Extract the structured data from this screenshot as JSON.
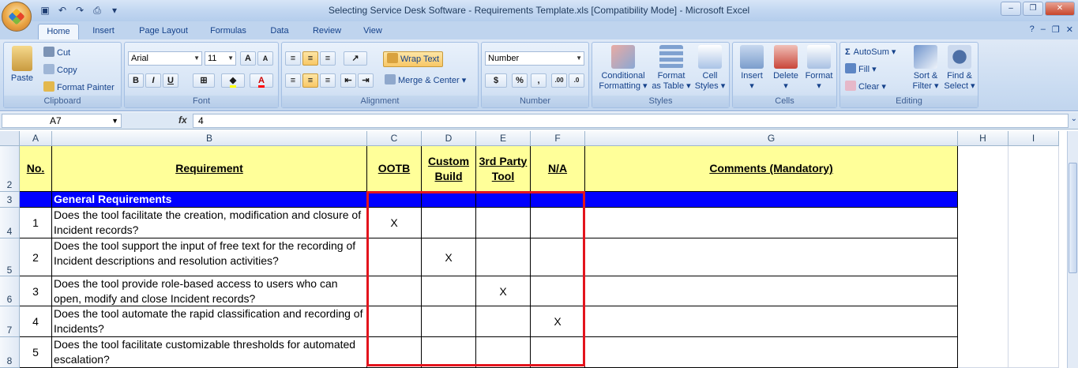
{
  "window": {
    "title": "Selecting Service Desk Software - Requirements Template.xls  [Compatibility Mode] - Microsoft Excel",
    "minimize": "–",
    "restore": "❐",
    "close": "✕"
  },
  "tabs": [
    "Home",
    "Insert",
    "Page Layout",
    "Formulas",
    "Data",
    "Review",
    "View"
  ],
  "ribbon": {
    "clipboard": {
      "label": "Clipboard",
      "paste": "Paste",
      "cut": "Cut",
      "copy": "Copy",
      "format_painter": "Format Painter"
    },
    "font": {
      "label": "Font",
      "name": "Arial",
      "size": "11",
      "bold": "B",
      "italic": "I",
      "underline": "U",
      "grow": "A",
      "shrink": "A",
      "color": "A"
    },
    "alignment": {
      "label": "Alignment",
      "wrap_text": "Wrap Text",
      "merge_center": "Merge & Center"
    },
    "number": {
      "label": "Number",
      "format": "Number",
      "currency": "$",
      "percent": "%",
      "comma": ",",
      "inc_decimal": ".00",
      "dec_decimal": ".0"
    },
    "styles": {
      "label": "Styles",
      "conditional": "Conditional",
      "conditional2": "Formatting",
      "format_table": "Format",
      "format_table2": "as Table",
      "cell_styles": "Cell",
      "cell_styles2": "Styles"
    },
    "cells": {
      "label": "Cells",
      "insert": "Insert",
      "delete": "Delete",
      "format": "Format"
    },
    "editing": {
      "label": "Editing",
      "autosum": "AutoSum",
      "fill": "Fill",
      "clear": "Clear",
      "sort": "Sort &",
      "sort2": "Filter",
      "find": "Find &",
      "find2": "Select"
    }
  },
  "formula_bar": {
    "name_box": "A7",
    "fx": "fx",
    "value": "4"
  },
  "columns": [
    "A",
    "B",
    "C",
    "D",
    "E",
    "F",
    "G",
    "H",
    "I"
  ],
  "rows": [
    "2",
    "3",
    "4",
    "5",
    "6",
    "7",
    "8"
  ],
  "header": {
    "no": "No.",
    "requirement": "Requirement",
    "ootb": "OOTB",
    "custom": "Custom Build",
    "third": "3rd Party Tool",
    "na": "N/A",
    "comments": "Comments (Mandatory)"
  },
  "section": "General Requirements",
  "requirements": [
    {
      "no": "1",
      "text": "Does the tool facilitate the creation, modification and closure of Incident records?",
      "ootb": "X",
      "custom": "",
      "third": "",
      "na": ""
    },
    {
      "no": "2",
      "text": "Does the tool support the input of free text for the recording of Incident descriptions and resolution activities?",
      "ootb": "",
      "custom": "X",
      "third": "",
      "na": ""
    },
    {
      "no": "3",
      "text": "Does the tool provide role-based access to users who can open, modify and close Incident records?",
      "ootb": "",
      "custom": "",
      "third": "X",
      "na": ""
    },
    {
      "no": "4",
      "text": "Does the tool automate the rapid classification and recording of Incidents?",
      "ootb": "",
      "custom": "",
      "third": "",
      "na": "X"
    },
    {
      "no": "5",
      "text": "Does the tool facilitate customizable thresholds for automated escalation?",
      "ootb": "",
      "custom": "",
      "third": "",
      "na": ""
    }
  ]
}
